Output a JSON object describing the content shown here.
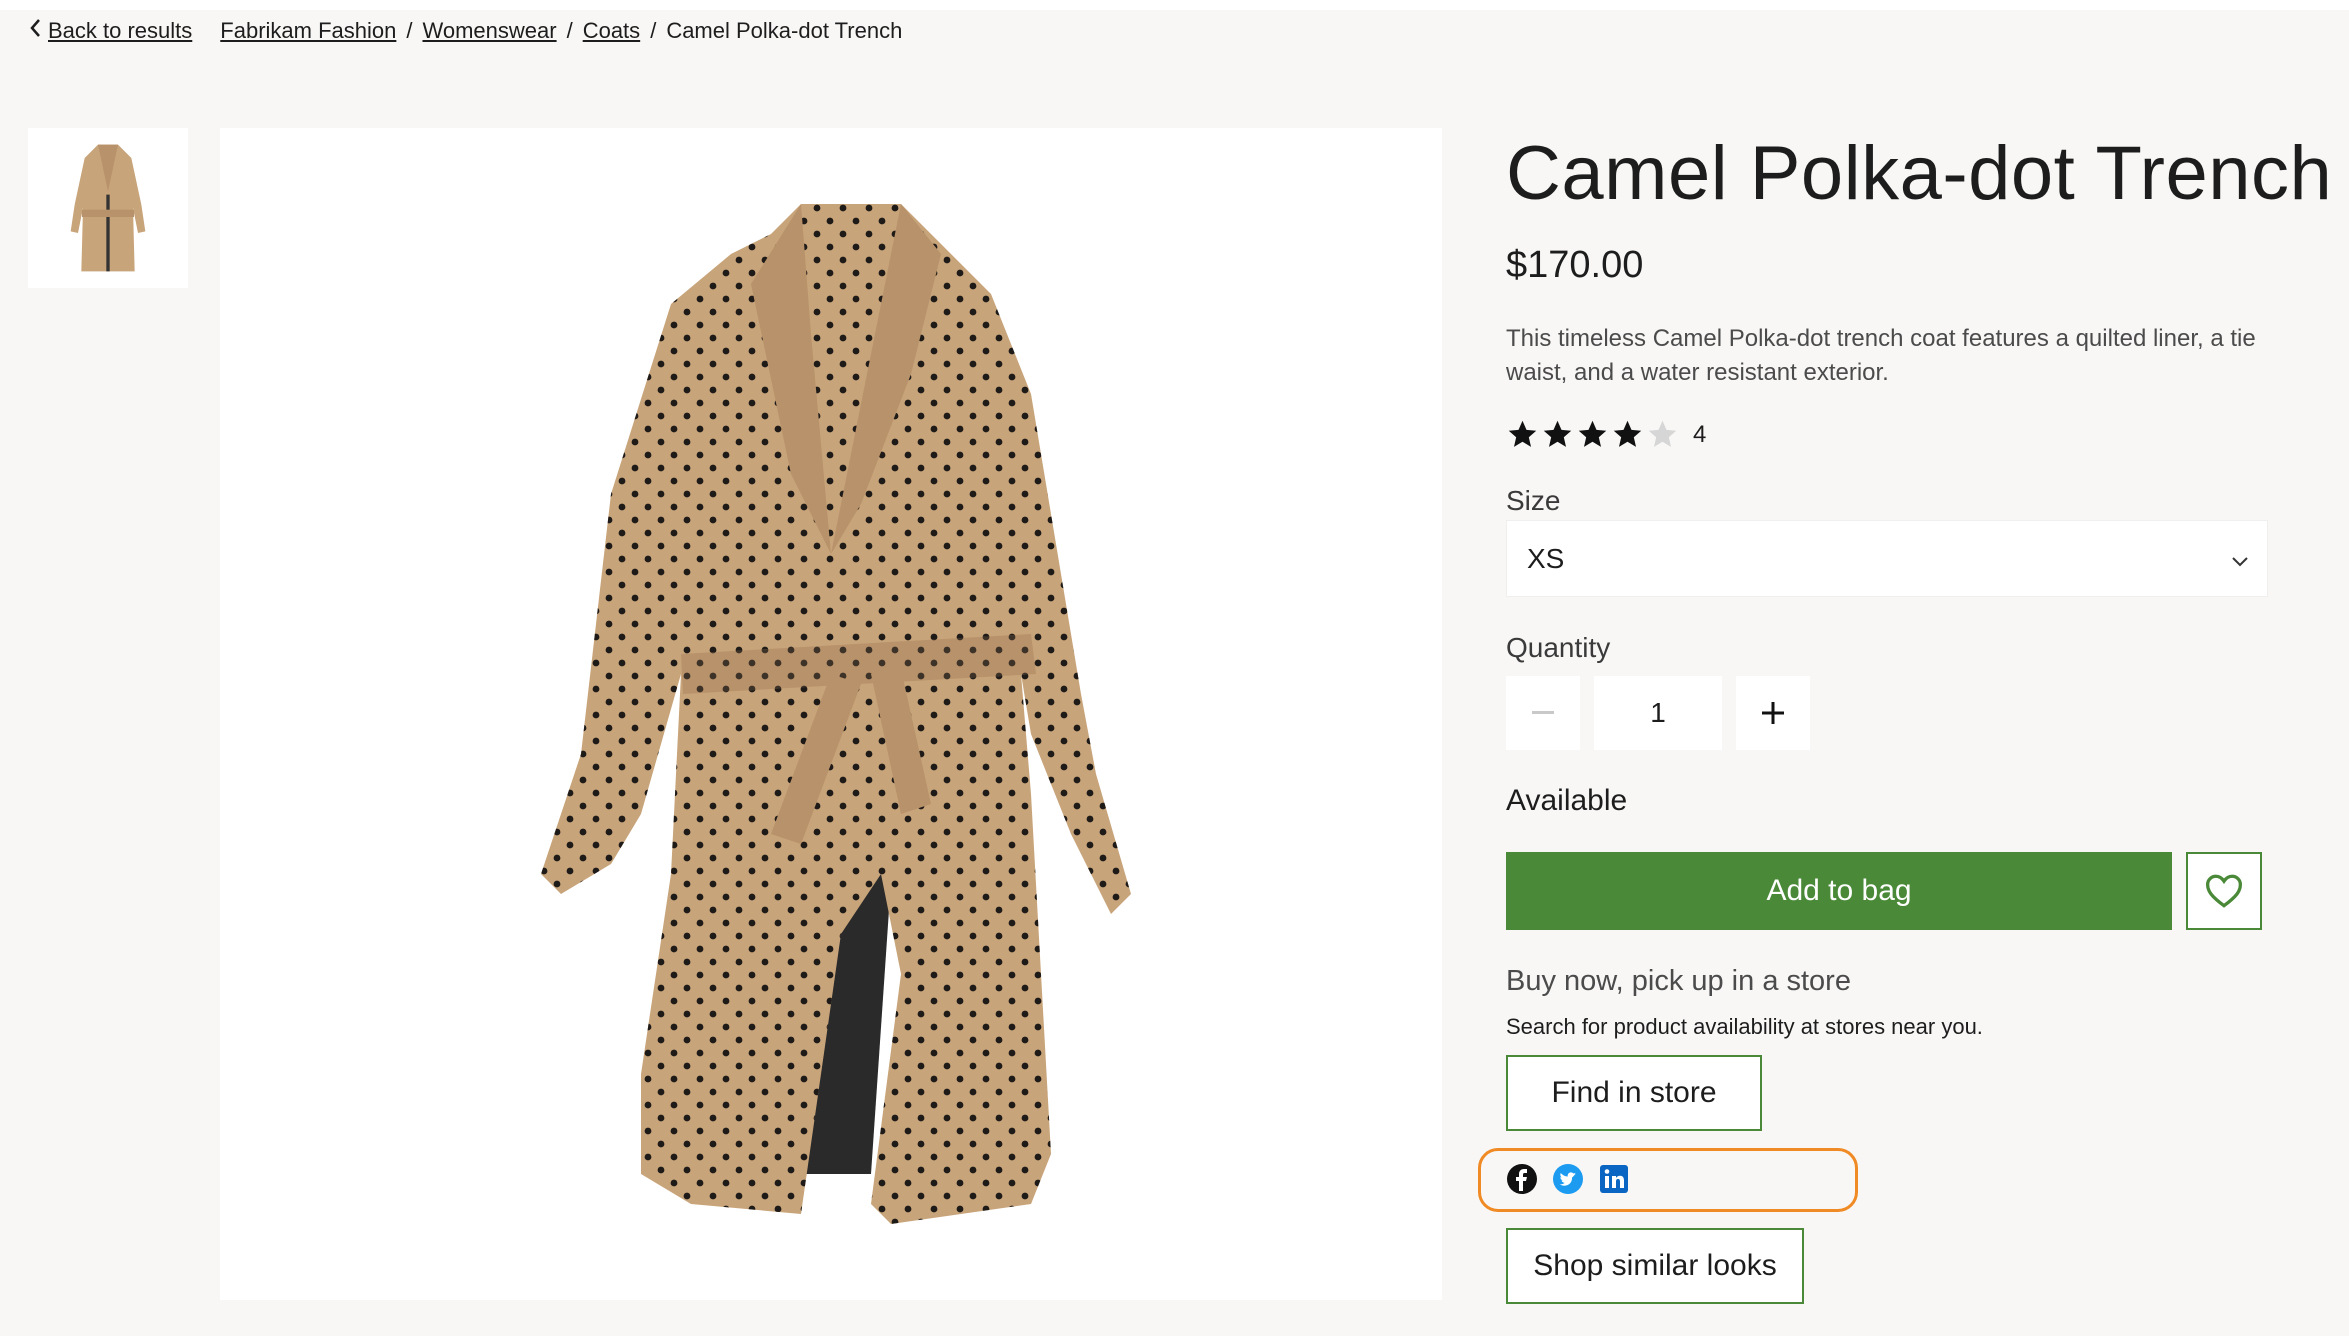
{
  "breadcrumb": {
    "back_label": "Back to results",
    "items": [
      "Fabrikam Fashion",
      "Womenswear",
      "Coats"
    ],
    "current": "Camel Polka-dot Trench",
    "separator": "/"
  },
  "product": {
    "title": "Camel Polka-dot Trench",
    "price": "$170.00",
    "description": "This timeless Camel Polka-dot trench coat features a quilted liner, a tie waist, and a water resistant exterior.",
    "rating": 4,
    "rating_max": 5,
    "rating_count": "4",
    "size_label": "Size",
    "size_value": "XS",
    "quantity_label": "Quantity",
    "quantity_value": "1",
    "availability": "Available"
  },
  "actions": {
    "add_to_bag": "Add to bag",
    "pickup_heading": "Buy now, pick up in a store",
    "pickup_subtext": "Search for product availability at stores near you.",
    "find_in_store": "Find in store",
    "shop_similar": "Shop similar looks"
  },
  "share": {
    "icons": [
      "facebook-icon",
      "twitter-icon",
      "linkedin-icon"
    ]
  },
  "colors": {
    "accent_green": "#498937",
    "highlight_orange": "#f08a24",
    "camel": "#c8a47a",
    "facebook": "#1877f2",
    "twitter": "#1d9bf0",
    "linkedin": "#0a66c2"
  }
}
